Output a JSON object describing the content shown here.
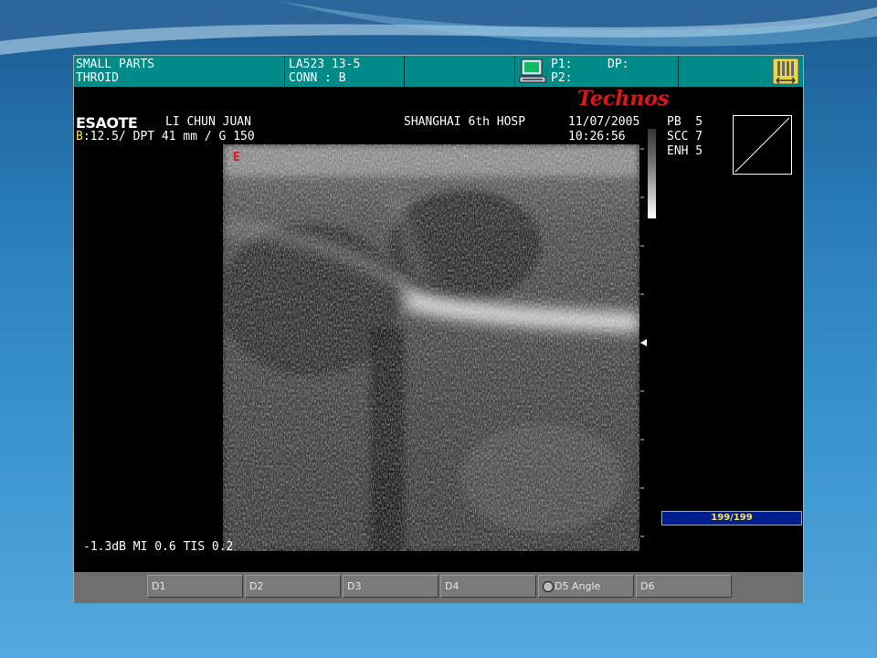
{
  "header": {
    "preset": "SMALL PARTS",
    "organ": "THROID",
    "probe": "LA523 13-5",
    "conn": "CONN : B",
    "p1": "P1:",
    "p2": "P2:",
    "dp": "DP:"
  },
  "brand": {
    "manufacturer": "ESAOTE",
    "model": "Technos"
  },
  "patient": {
    "name": "LI CHUN JUAN",
    "hospital": "SHANGHAI 6th HOSP",
    "date": "11/07/2005",
    "time": "10:26:56"
  },
  "imaging": {
    "mode_prefix": "B",
    "settings": ":12.5/ DPT 41 mm / G 150",
    "pb": "PB  5",
    "scc": "SCC 7",
    "enh": "ENH 5",
    "marker": "E",
    "output": "-1.3dB MI 0.6 TIS 0.2",
    "frame_counter": "199/199"
  },
  "function_keys": [
    {
      "label": "D1"
    },
    {
      "label": "D2"
    },
    {
      "label": "D3"
    },
    {
      "label": "D4"
    },
    {
      "label": "D5 Angle"
    },
    {
      "label": "D6"
    }
  ],
  "colors": {
    "header_bg": "#008a88",
    "accent_red": "#e0151b",
    "counter_bg": "#001f8f",
    "counter_text": "#ffe14a"
  },
  "icons": [
    "monitor-icon",
    "scan-area-icon",
    "angle-knob-icon"
  ]
}
